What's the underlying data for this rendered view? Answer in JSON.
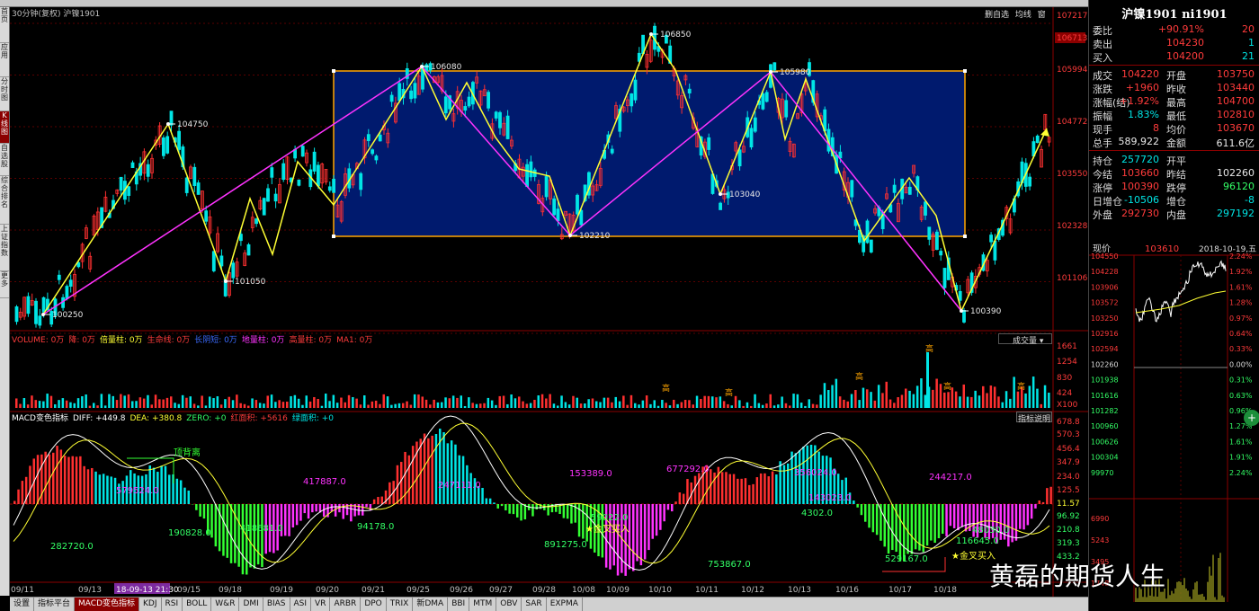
{
  "header": {
    "period_title": "30分钟(复权)",
    "symbol_name": "沪镍1901"
  },
  "top_right_buttons": [
    "删自选",
    "均线",
    "窗"
  ],
  "left_nav": [
    "首页",
    "应用",
    "分时图",
    "K线图",
    "自选股",
    "综合排名",
    "上证指数",
    "更多"
  ],
  "main_chart": {
    "price_axis": [
      "107217",
      "106713",
      "105994",
      "104772",
      "103550",
      "102328",
      "101106"
    ],
    "price_axis_highlight": "106713",
    "zigzag_labels": [
      "100250",
      "104750",
      "101050",
      "106080",
      "102210",
      "106850",
      "105980",
      "103040",
      "100390"
    ]
  },
  "volume": {
    "legend": [
      {
        "t": "VOLUME: 0万",
        "c": "#ff3b3b"
      },
      {
        "t": "降: 0万",
        "c": "#ff3b3b"
      },
      {
        "t": "倍量柱: 0万",
        "c": "#ffff33"
      },
      {
        "t": "生命线: 0万",
        "c": "#ff3b3b"
      },
      {
        "t": "长阴短: 0万",
        "c": "#3b6bff"
      },
      {
        "t": "地量柱: 0万",
        "c": "#ff33ff"
      },
      {
        "t": "高量柱: 0万",
        "c": "#ff3b3b"
      },
      {
        "t": "MA1: 0万",
        "c": "#ff3b3b"
      }
    ],
    "selector": "成交量",
    "axis": [
      "1661",
      "1254",
      "830",
      "424",
      "X100"
    ],
    "label_high": "高"
  },
  "macd": {
    "legend": [
      {
        "t": "MACD变色指标",
        "c": "#ffffff"
      },
      {
        "t": "DIFF: +449.8",
        "c": "#ffffff"
      },
      {
        "t": "DEA: +380.8",
        "c": "#ffff33"
      },
      {
        "t": "ZERO: +0",
        "c": "#33ff66"
      },
      {
        "t": "红面积: +5616",
        "c": "#ff3b3b"
      },
      {
        "t": "绿面积: +0",
        "c": "#00e5e5"
      }
    ],
    "help": "指标说明",
    "axis": [
      "678.8",
      "570.3",
      "456.4",
      "347.9",
      "234.0",
      "125.5",
      "11.57",
      "96.92",
      "210.8",
      "319.3",
      "433.2"
    ],
    "annotations": {
      "top_divergence": "顶背离",
      "golden_cross": "★金叉买入",
      "golden_cross2": "★金叉买入"
    },
    "area_labels": [
      "579524.0",
      "282720.0",
      "190828.0",
      "418681.0",
      "417887.0",
      "94178.0",
      "247111.0",
      "153389.0",
      "59022.0",
      "891275.0",
      "677292.0",
      "753867.0",
      "356024.0",
      "143023.0",
      "4302.0",
      "244217.0",
      "529167.0",
      "116645.0",
      "48030.0"
    ]
  },
  "date_axis": [
    "09/11",
    "09/13",
    "18-09-13 21:30",
    "09/15",
    "09/18",
    "09/19",
    "09/20",
    "09/21",
    "09/25",
    "09/26",
    "09/27",
    "09/28",
    "10/08",
    "10/09",
    "10/10",
    "10/11",
    "10/12",
    "10/13",
    "10/16",
    "10/17",
    "10/18"
  ],
  "bottom_tabs": [
    "设置",
    "指标平台",
    "MACD变色指标",
    "KDJ",
    "RSI",
    "BOLL",
    "W&R",
    "DMI",
    "BIAS",
    "ASI",
    "VR",
    "ARBR",
    "DPO",
    "TRIX",
    "新DMA",
    "BBI",
    "MTM",
    "OBV",
    "SAR",
    "EXPMA"
  ],
  "bottom_tab_active": "MACD变色指标",
  "side": {
    "title": "沪镍1901 ni1901",
    "order": [
      {
        "l": "委比",
        "v": "+90.91%",
        "v2": "20",
        "vc": "red",
        "v2c": "red"
      },
      {
        "l": "卖出",
        "v": "104230",
        "v2": "1",
        "vc": "red",
        "v2c": "cyan"
      },
      {
        "l": "买入",
        "v": "104200",
        "v2": "21",
        "vc": "red",
        "v2c": "cyan"
      }
    ],
    "stats": [
      {
        "l": "成交",
        "v": "104220",
        "vc": "red",
        "l2": "开盘",
        "v2": "103750",
        "v2c": "red"
      },
      {
        "l": "涨跌",
        "v": "+1960",
        "vc": "red",
        "l2": "昨收",
        "v2": "103440",
        "v2c": "red"
      },
      {
        "l": "涨幅(结)",
        "v": "+1.92%",
        "vc": "red",
        "l2": "最高",
        "v2": "104700",
        "v2c": "red"
      },
      {
        "l": "振幅",
        "v": "1.83%",
        "vc": "cyan",
        "l2": "最低",
        "v2": "102810",
        "v2c": "red"
      },
      {
        "l": "现手",
        "v": "8",
        "vc": "red",
        "l2": "均价",
        "v2": "103670",
        "v2c": "red"
      },
      {
        "l": "总手",
        "v": "589,922",
        "vc": "white",
        "l2": "金额",
        "v2": "611.6亿",
        "v2c": "white"
      }
    ],
    "position": [
      {
        "l": "持仓",
        "v": "257720",
        "vc": "cyan",
        "l2": "开平",
        "v2": "",
        "v2c": "white"
      },
      {
        "l": "今结",
        "v": "103660",
        "vc": "red",
        "l2": "昨结",
        "v2": "102260",
        "v2c": "white"
      },
      {
        "l": "涨停",
        "v": "100390",
        "vc": "red",
        "l2": "跌停",
        "v2": "96120",
        "v2c": "green"
      },
      {
        "l": "日增仓",
        "v": "-10506",
        "vc": "cyan",
        "l2": "增仓",
        "v2": "-8",
        "v2c": "cyan"
      },
      {
        "l": "外盘",
        "v": "292730",
        "vc": "red",
        "l2": "内盘",
        "v2": "297192",
        "v2c": "cyan"
      }
    ],
    "mini_header": {
      "l": "现价",
      "v": "103610",
      "date": "2018-10-19,五"
    },
    "mini_axis_left": [
      "104550",
      "104228",
      "103906",
      "103572",
      "103250",
      "102916",
      "102594",
      "102260",
      "101938",
      "101616",
      "101282",
      "100960",
      "100626",
      "100304",
      "99970",
      "6990",
      "5243",
      "3495",
      "1748"
    ],
    "mini_axis_right": [
      "2.24%",
      "1.92%",
      "1.61%",
      "1.28%",
      "0.97%",
      "0.64%",
      "0.33%",
      "0.00%",
      "0.31%",
      "0.63%",
      "0.96%",
      "1.27%",
      "1.61%",
      "1.91%",
      "2.24%"
    ]
  },
  "watermark": "黄磊的期货人生"
}
